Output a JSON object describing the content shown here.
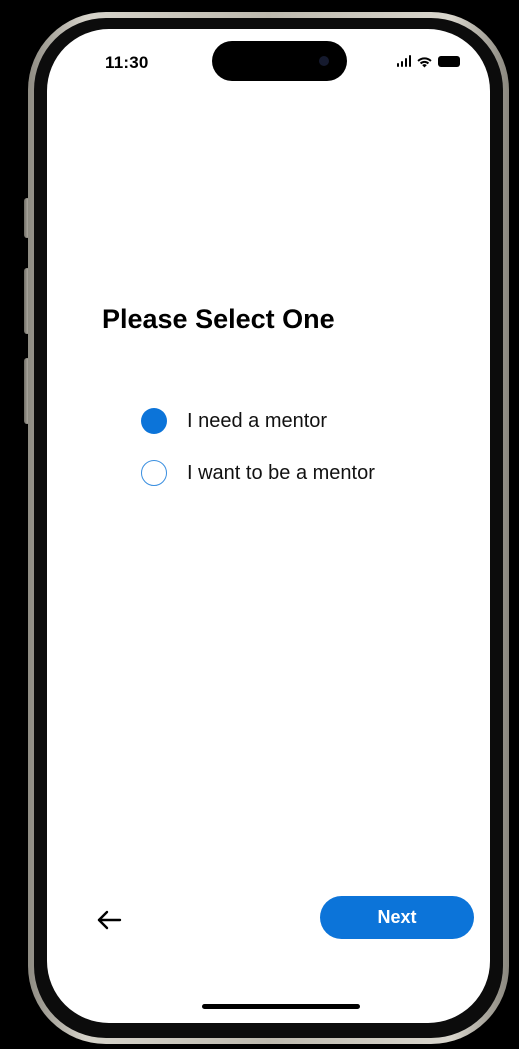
{
  "status_bar": {
    "time": "11:30",
    "icons": [
      "signal-icon",
      "wifi-icon",
      "battery-icon"
    ]
  },
  "title": "Please Select One",
  "options": [
    {
      "label": "I need a mentor",
      "selected": true
    },
    {
      "label": "I want to be a mentor",
      "selected": false
    }
  ],
  "navigation": {
    "back_icon": "arrow-left-icon",
    "next_label": "Next"
  },
  "colors": {
    "accent": "#0c74d9",
    "background": "#ffffff",
    "text": "#000000"
  }
}
